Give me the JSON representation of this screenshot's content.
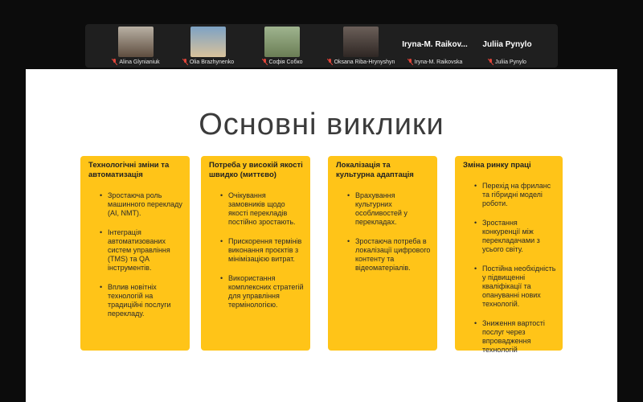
{
  "participants": [
    {
      "label": "Alina Glynianiuk",
      "thumb_colors": [
        "#b9b1a4",
        "#5e4d3f"
      ]
    },
    {
      "label": "Olia Brazhynenko",
      "thumb_colors": [
        "#7da2c5",
        "#d9c29b"
      ]
    },
    {
      "label": "Софія Собко",
      "thumb_colors": [
        "#9fb48f",
        "#6b7e55"
      ]
    },
    {
      "label": "Oksana Riba-Hrynyshyn",
      "thumb_colors": [
        "#6b5f59",
        "#2f2724"
      ]
    },
    {
      "label": "Iryna-M. Raikovska",
      "display_name": "Iryna-M. Raikov..."
    },
    {
      "label": "Juliia Pynylo",
      "display_name": "Juliia Pynylo"
    }
  ],
  "slide": {
    "title": "Основні виклики",
    "cards": [
      {
        "title": "Технологічні зміни та автоматизація",
        "bullets": [
          "Зростаюча роль машинного перекладу (AI, NMT).",
          "Інтеграція автоматизованих систем управління (TMS) та QA інструментів.",
          "Вплив новітніх технологій на традиційні послуги перекладу."
        ]
      },
      {
        "title": "Потреба у високій якості швидко (миттєво)",
        "bullets": [
          "Очікування замовників щодо якості перекладів постійно зростають.",
          "Прискорення термінів виконання проєктів з мінімізацією витрат.",
          "Використання комплексних стратегій для управління термінологією."
        ]
      },
      {
        "title": "Локалізація та культурна адаптація",
        "bullets": [
          "Врахування культурних особливостей у перекладах.",
          "Зростаюча потреба в локалізації цифрового контенту та відеоматеріалів."
        ]
      },
      {
        "title": "Зміна ринку праці",
        "bullets": [
          "Перехід на фриланс та гібридні моделі роботи.",
          "Зростання конкуренції між перекладачами з усього світу.",
          "Постійна необхідність у підвищенні кваліфікації та опануванні нових технологій.",
          "Зниження вартості послуг через впровадження технологій"
        ]
      }
    ]
  },
  "colors": {
    "card": "#ffc418",
    "mic_off": "#e0453a",
    "strip": "#1f1f1f"
  }
}
